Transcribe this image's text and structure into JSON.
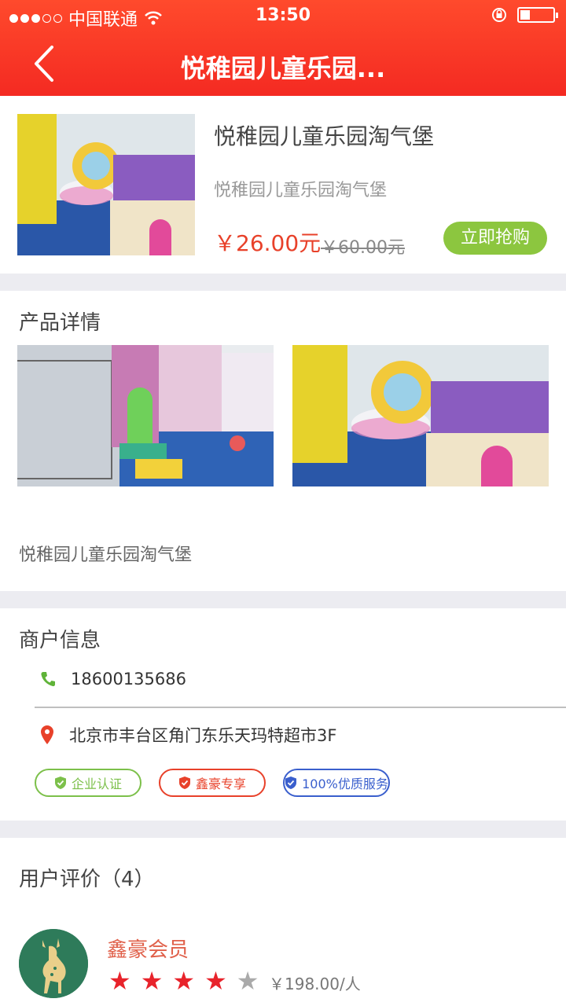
{
  "status_bar": {
    "carrier": "中国联通",
    "time": "13:50"
  },
  "nav": {
    "title": "悦稚园儿童乐园..."
  },
  "product": {
    "name": "悦稚园儿童乐园淘气堡",
    "subtitle": "悦稚园儿童乐园淘气堡",
    "price": "￥26.00元",
    "original_price": "￥60.00元",
    "buy_label": "立即抢购"
  },
  "details": {
    "title": "产品详情",
    "description": "悦稚园儿童乐园淘气堡"
  },
  "merchant": {
    "title": "商户信息",
    "phone": "18600135686",
    "address": "北京市丰台区角门东乐天玛特超市3F",
    "badges": [
      {
        "label": "企业认证",
        "color": "#7cc04a"
      },
      {
        "label": "鑫豪专享",
        "color": "#e8412a"
      },
      {
        "label": "100%优质服务",
        "color": "#3a5fcd"
      }
    ]
  },
  "reviews": {
    "title": "用户评价（4）",
    "items": [
      {
        "name": "鑫豪会员",
        "rating": 4,
        "max_rating": 5,
        "price": "￥198.00/人"
      }
    ]
  },
  "colors": {
    "accent": "#f42a22",
    "buy_green": "#8cc63f",
    "star_on": "#e8232b",
    "star_off": "#aaaaaa"
  }
}
